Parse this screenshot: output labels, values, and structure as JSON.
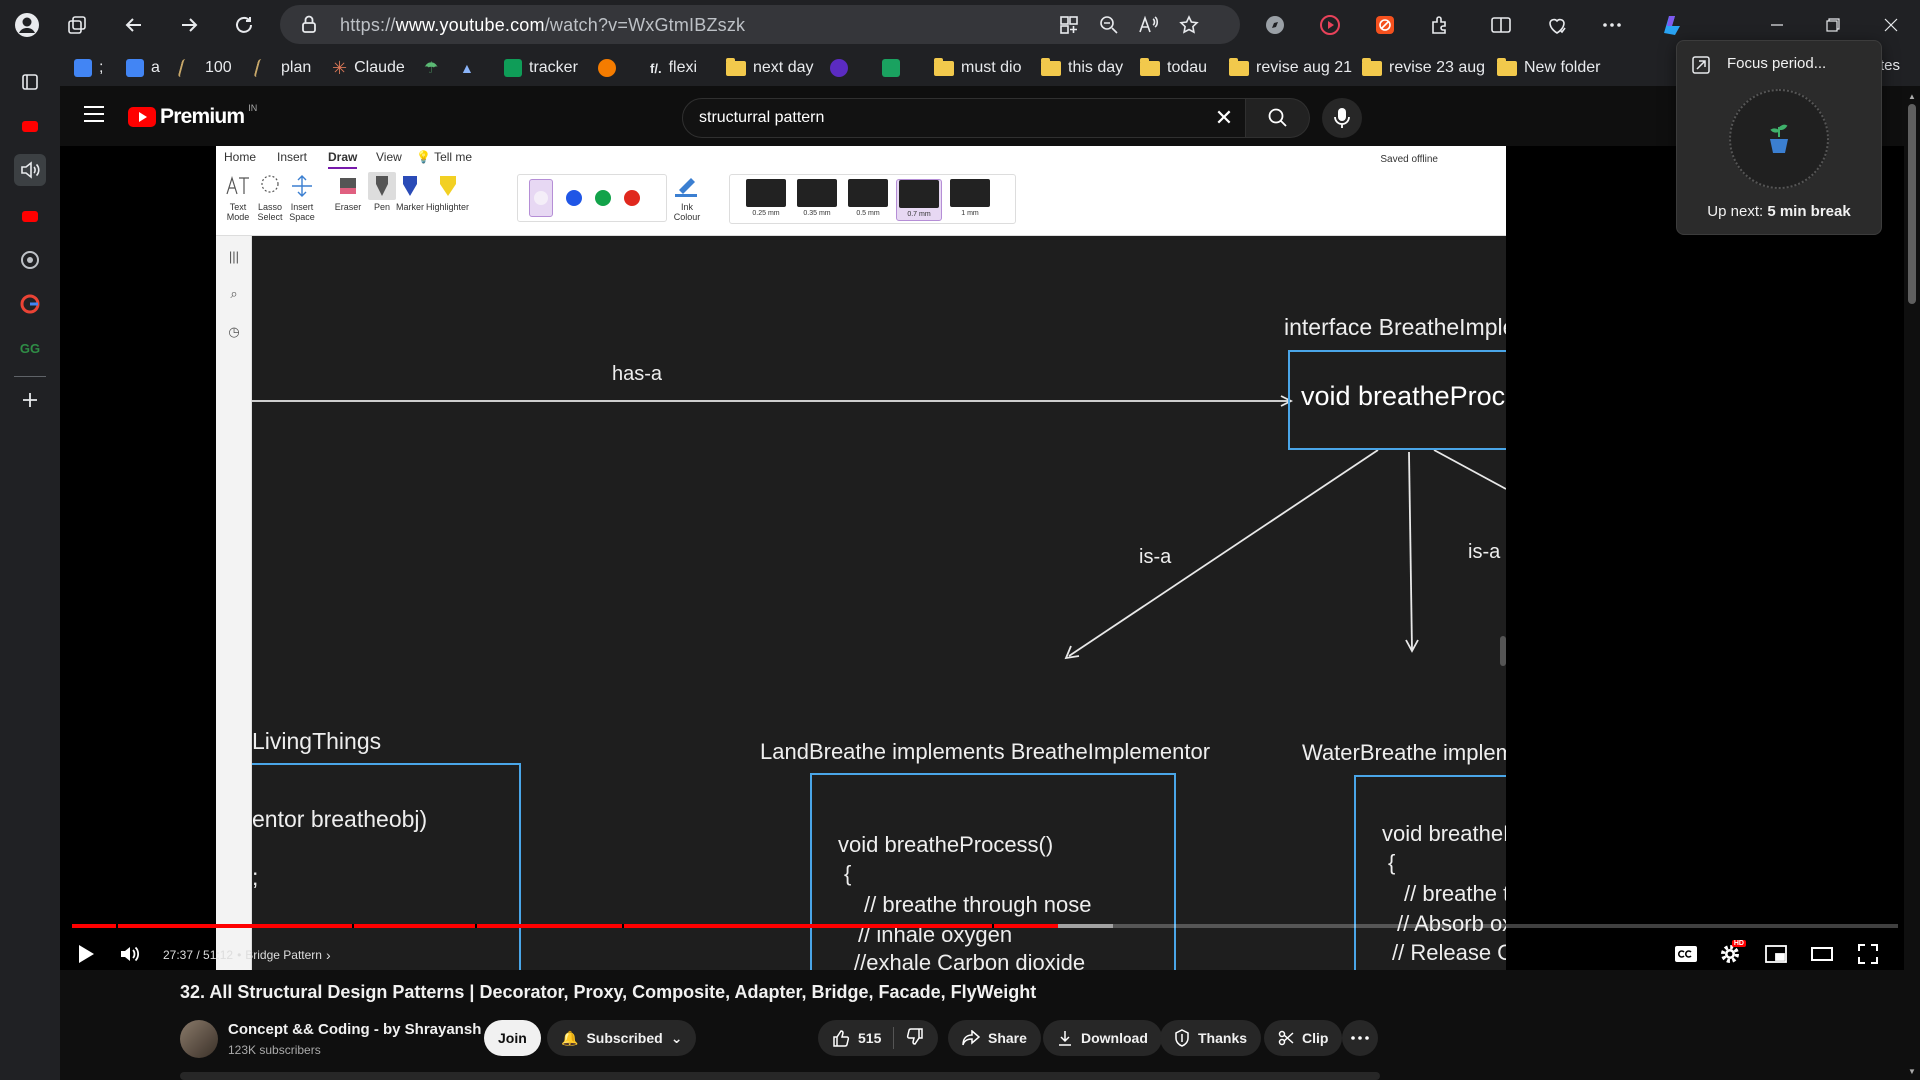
{
  "browser": {
    "url_prefix": "https://",
    "url_host": "www.youtube.com",
    "url_path": "/watch?v=WxGtmIBZszk"
  },
  "bookmarks": [
    {
      "label": ";",
      "icon": "docs-icon",
      "color": "#4285f4"
    },
    {
      "label": "a",
      "icon": "docs-icon",
      "color": "#4285f4"
    },
    {
      "label": "100",
      "icon": "diamond-icon",
      "color": "#c8a86a"
    },
    {
      "label": "plan",
      "icon": "diamond-icon",
      "color": "#c8a86a"
    },
    {
      "label": "Claude",
      "icon": "claude-icon",
      "color": "#d97757"
    },
    {
      "label": "",
      "icon": "leaf-icon",
      "color": "#5bb974"
    },
    {
      "label": "",
      "icon": "mountain-icon",
      "color": "#8ab4f8"
    },
    {
      "label": "tracker",
      "icon": "sheets-icon",
      "color": "#0f9d58"
    },
    {
      "label": "",
      "icon": "orange-dot-icon",
      "color": "#f57c00"
    },
    {
      "label": "flexi",
      "icon": "flexi-icon",
      "color": "#e8eaed"
    },
    {
      "label": "next day",
      "icon": "folder-icon",
      "color": "#f2c94c"
    },
    {
      "label": "",
      "icon": "purple-badge-icon",
      "color": "#5b2bc1"
    },
    {
      "label": "",
      "icon": "green-power-icon",
      "color": "#1aa260"
    },
    {
      "label": "must dio",
      "icon": "folder-icon",
      "color": "#f2c94c"
    },
    {
      "label": "this day",
      "icon": "folder-icon",
      "color": "#f2c94c"
    },
    {
      "label": "todau",
      "icon": "folder-icon",
      "color": "#f2c94c"
    },
    {
      "label": "revise aug 21",
      "icon": "folder-icon",
      "color": "#f2c94c"
    },
    {
      "label": "revise 23 aug",
      "icon": "folder-icon",
      "color": "#f2c94c"
    },
    {
      "label": "New folder",
      "icon": "folder-icon",
      "color": "#f2c94c"
    }
  ],
  "bookmarks_tail": "tes",
  "youtube": {
    "logo_text": "Premium",
    "region": "IN",
    "search_query": "structurral pattern"
  },
  "onenote": {
    "tabs": [
      "Home",
      "Insert",
      "Draw",
      "View",
      "Tell me"
    ],
    "active_tab": "Draw",
    "tools": [
      {
        "label": "Text\nMode"
      },
      {
        "label": "Lasso\nSelect"
      },
      {
        "label": "Insert\nSpace"
      },
      {
        "label": "Eraser"
      },
      {
        "label": "Pen"
      },
      {
        "label": "Marker"
      },
      {
        "label": "Highlighter"
      }
    ],
    "ink_colour": "Ink\nColour",
    "pen_sizes": [
      "0.25 mm",
      "0.35 mm",
      "0.5 mm",
      "0.7 mm",
      "1 mm"
    ],
    "selected_pen": "0.7 mm",
    "saved_status": "Saved offline"
  },
  "diagram": {
    "has_a": "has-a",
    "interface_title": "interface BreatheImplementor",
    "interface_method": "void breatheProcess();",
    "is_a": "is-a",
    "living_title": "LivingThings",
    "living_line1": "entor breatheobj)",
    "living_line2": ";",
    "land_title": "LandBreathe implements BreatheImplementor",
    "land_lines": [
      "void breatheProcess()",
      "{",
      "// breathe through nose",
      "// inhale oxygen",
      "//exhale Carbon dioxide"
    ],
    "water_title": "WaterBreathe implements BreatheImplemer",
    "water_lines": [
      "void breatheProcess()",
      "{",
      "// breathe through Gills",
      "// Absorb oxygen",
      "// Release Carbon dioxide"
    ]
  },
  "player": {
    "time": "27:37 / 51:12",
    "chapter": "Bridge Pattern",
    "progress_fraction": 0.54,
    "buffered_fraction": 0.57
  },
  "video": {
    "title": "32. All Structural Design Patterns | Decorator, Proxy, Composite, Adapter, Bridge, Facade, FlyWeight",
    "channel": "Concept && Coding - by Shrayansh",
    "subscribers": "123K subscribers",
    "join": "Join",
    "subscribed": "Subscribed",
    "likes": "515",
    "share": "Share",
    "download": "Download",
    "thanks": "Thanks",
    "clip": "Clip"
  },
  "focus": {
    "title": "Focus period...",
    "up_next_prefix": "Up next: ",
    "up_next": "5 min break"
  },
  "colors": {
    "accent": "#ff0000",
    "onenote_purple": "#7719aa"
  }
}
